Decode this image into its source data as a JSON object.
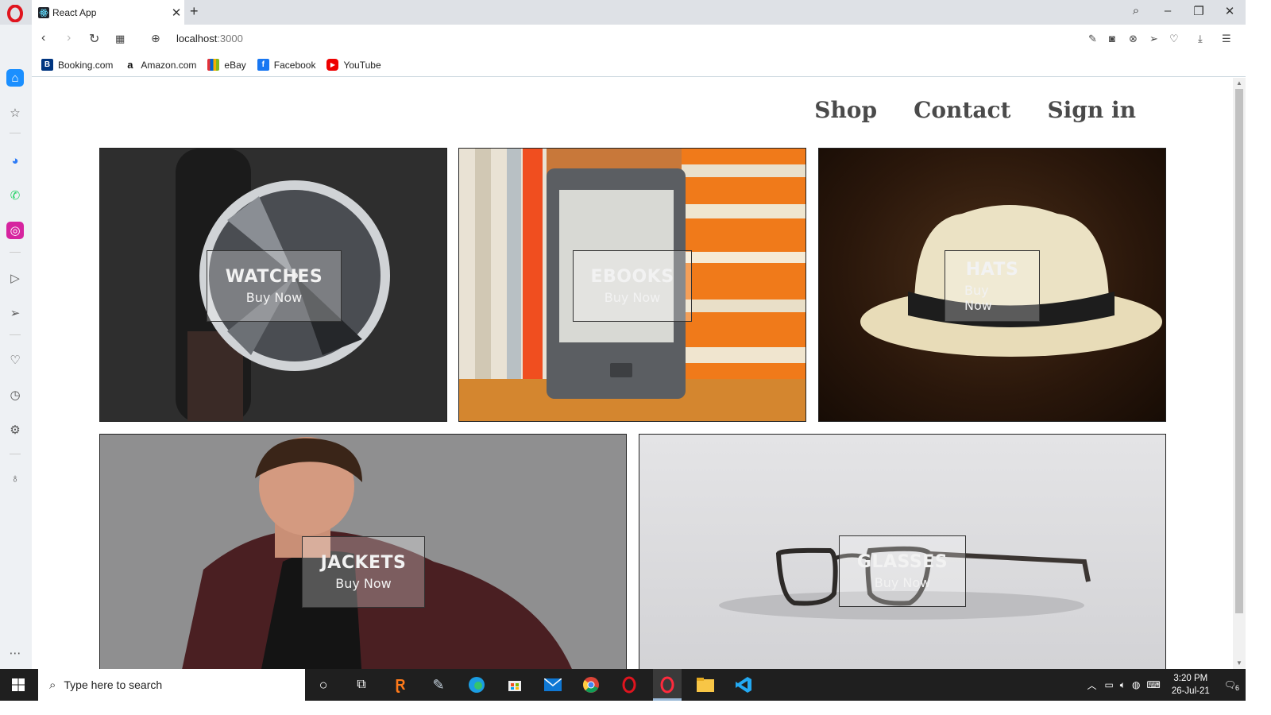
{
  "browser": {
    "tab_title": "React App",
    "url_host": "localhost",
    "url_port": ":3000",
    "bookmarks": [
      {
        "label": "Booking.com",
        "icon": "booking-icon"
      },
      {
        "label": "Amazon.com",
        "icon": "amazon-icon"
      },
      {
        "label": "eBay",
        "icon": "ebay-icon"
      },
      {
        "label": "Facebook",
        "icon": "facebook-icon"
      },
      {
        "label": "YouTube",
        "icon": "youtube-icon"
      }
    ]
  },
  "nav": {
    "shop": "Shop",
    "contact": "Contact",
    "signin": "Sign in"
  },
  "categories": [
    {
      "name": "WATCHES",
      "cta": "Buy Now"
    },
    {
      "name": "EBOOKS",
      "cta": "Buy Now"
    },
    {
      "name": "HATS",
      "cta": "Buy Now"
    },
    {
      "name": "JACKETS",
      "cta": "Buy Now"
    },
    {
      "name": "GLASSES",
      "cta": "Buy Now"
    }
  ],
  "taskbar": {
    "search_placeholder": "Type here to search",
    "time": "3:20 PM",
    "date": "26-Jul-21",
    "notifications": "6"
  },
  "colors": {
    "nav_text": "#4a4a4a",
    "taskbar_bg": "#1f1f1f",
    "sidebar_active": "#1a8fff"
  }
}
